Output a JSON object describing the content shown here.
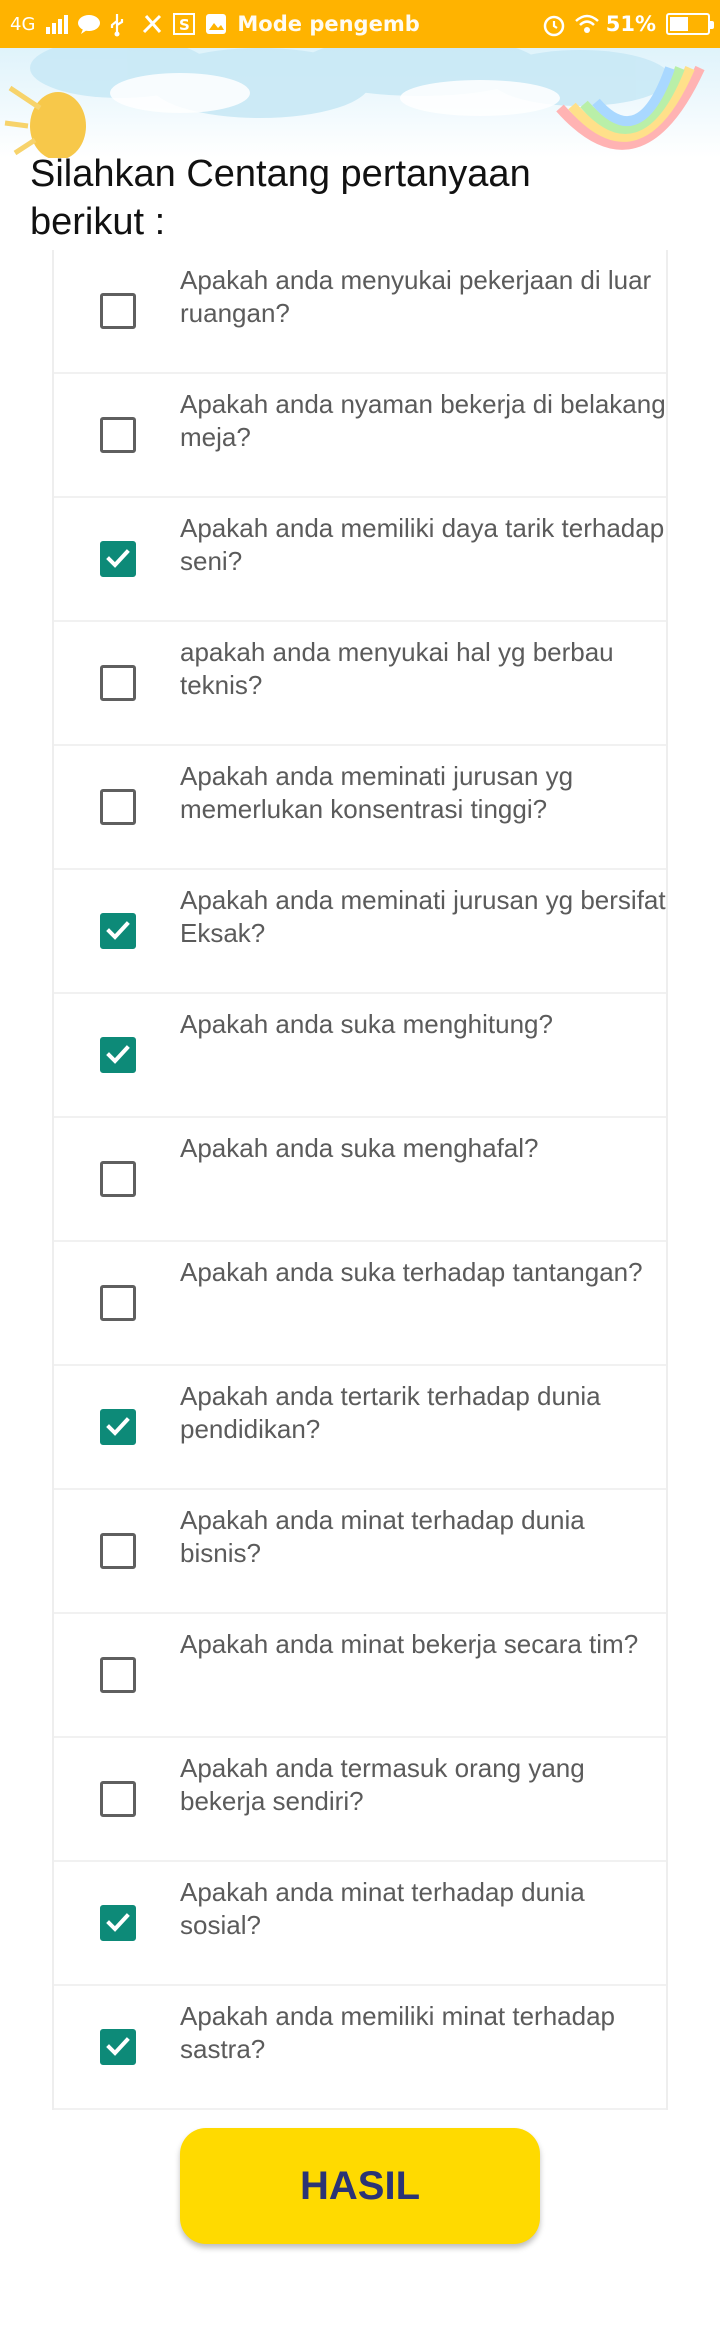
{
  "status_bar": {
    "network": "4G",
    "mode_text": "Mode pengemb",
    "battery_percent": "51%",
    "battery_level": 0.51,
    "icons": [
      "signal-icon",
      "chat-icon",
      "usb-icon",
      "tools-icon",
      "s-icon",
      "gallery-icon",
      "alarm-icon",
      "wifi-icon",
      "battery-icon"
    ]
  },
  "page": {
    "title": "Silahkan Centang pertanyaan berikut :"
  },
  "questions": [
    {
      "text": "Apakah anda menyukai pekerjaan di luar ruangan?",
      "checked": false
    },
    {
      "text": "Apakah anda nyaman bekerja di belakang meja?",
      "checked": false
    },
    {
      "text": "Apakah anda memiliki daya tarik terhadap seni?",
      "checked": true
    },
    {
      "text": "apakah anda menyukai hal yg berbau teknis?",
      "checked": false
    },
    {
      "text": "Apakah anda meminati jurusan yg memerlukan konsentrasi tinggi?",
      "checked": false
    },
    {
      "text": "Apakah anda meminati jurusan yg bersifat Eksak?",
      "checked": true
    },
    {
      "text": "Apakah anda suka menghitung?",
      "checked": true
    },
    {
      "text": "Apakah anda suka menghafal?",
      "checked": false
    },
    {
      "text": "Apakah anda suka terhadap tantangan?",
      "checked": false
    },
    {
      "text": "Apakah anda tertarik terhadap dunia pendidikan?",
      "checked": true
    },
    {
      "text": "Apakah anda minat terhadap dunia bisnis?",
      "checked": false
    },
    {
      "text": "Apakah anda minat bekerja secara tim?",
      "checked": false
    },
    {
      "text": "Apakah anda termasuk orang yang bekerja sendiri?",
      "checked": false
    },
    {
      "text": "Apakah anda minat terhadap dunia sosial?",
      "checked": true
    },
    {
      "text": "Apakah anda memiliki minat terhadap sastra?",
      "checked": true
    }
  ],
  "buttons": {
    "result_label": "HASIL"
  },
  "colors": {
    "status_bar": "#FFB300",
    "checkbox_checked": "#0d8a78",
    "button_bg": "#FFDA00",
    "button_text": "#2b3475"
  }
}
